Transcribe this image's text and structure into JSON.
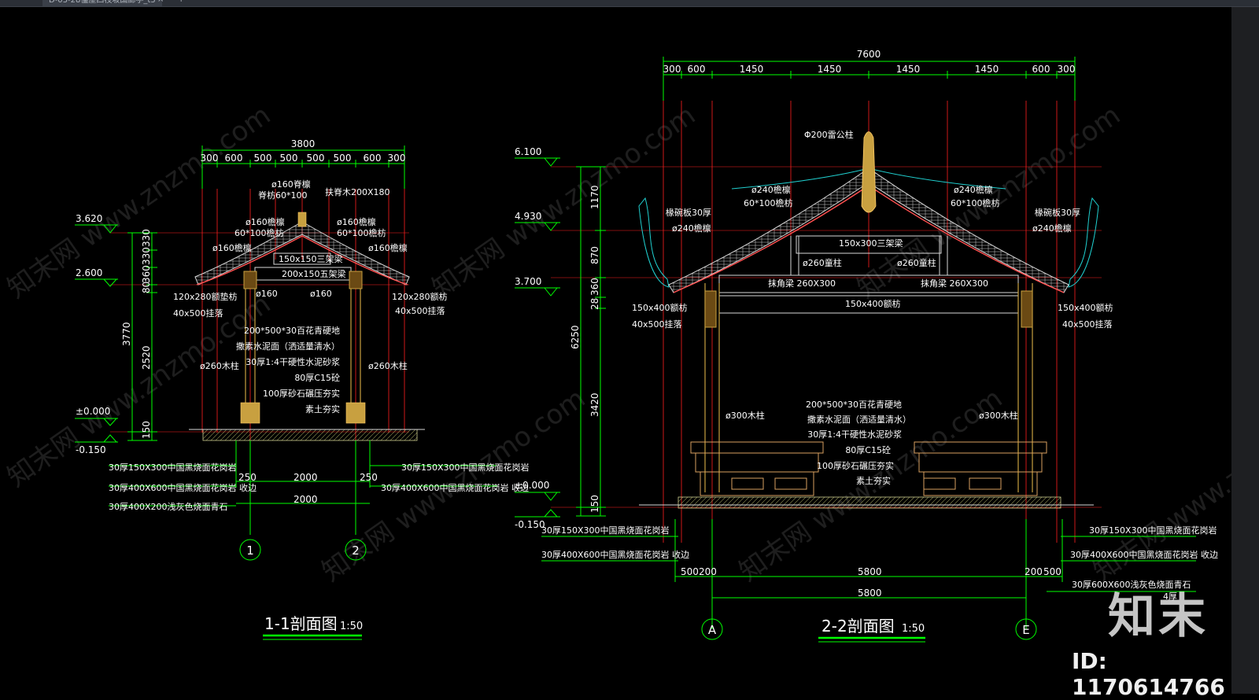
{
  "tab": {
    "title": "D-03-28僵屋四枝坡国廊亭_t3",
    "close": "×",
    "add": "+"
  },
  "watermark": {
    "text": "知末网 www.znzmo.com",
    "brand": "知末",
    "id": "ID: 1170614766"
  },
  "colors": {
    "frame": "#ffffff",
    "dim": "#00ff00",
    "axis": "#ff2020",
    "roof": "#d9d9d9",
    "timber": "#c8a040",
    "cyan": "#20d0d0",
    "text": "#ffffff"
  },
  "section1": {
    "title": "1-1剖面图",
    "scale": "1:50",
    "overall_dim": "3800",
    "top_dims": [
      "300",
      "600",
      "500",
      "500",
      "500",
      "500",
      "600",
      "300"
    ],
    "levels": [
      "3.620",
      "2.600",
      "±0.000",
      "-0.150"
    ],
    "vert_dims": [
      "330",
      "330",
      "360",
      "80",
      "2520",
      "3770",
      "150"
    ],
    "bottom_dims": [
      "250",
      "2000",
      "250",
      "2000"
    ],
    "axes": [
      "1",
      "2"
    ],
    "labels": {
      "ridge": "ø160脊檩",
      "ridge_tie": "脊枋60*100",
      "fuxi": "扶脊木200X180",
      "purlin_l": "ø160檐檩",
      "purlin_r": "ø160檐檩",
      "fang_l": "60*100檐枋",
      "fang_r": "60*100檐枋",
      "eave_l": "ø160檐檩",
      "eave_r": "ø160檐檩",
      "beam3": "150x150三架梁",
      "beam5": "200x150五架梁",
      "dian_l": "120x280额垫枋",
      "dian_r": "120x280额枋",
      "post_l": "ø160",
      "post_r": "ø160",
      "gua_l": "40x500挂落",
      "gua_r": "40x500挂落",
      "col_l": "ø260木柱",
      "col_r": "ø260木柱"
    },
    "floor_layers": [
      "200*500*30百花青硬地",
      "撒素水泥面（洒适量清水）",
      "30厚1:4干硬性水泥砂浆",
      "80厚C15砼",
      "100厚砂石碾压夯实",
      "素土夯实"
    ],
    "paving": [
      "30厚150X300中国黑烧面花岗岩",
      "30厚400X600中国黑烧面花岗岩 收边",
      "30厚400X200浅灰色烧面青石",
      "30厚150X300中国黑烧面花岗岩",
      "30厚400X600中国黑烧面花岗岩 收边"
    ]
  },
  "section2": {
    "title": "2-2剖面图",
    "scale": "1:50",
    "overall_dim": "7600",
    "top_dims": [
      "300",
      "600",
      "1450",
      "1450",
      "1450",
      "1450",
      "600",
      "300"
    ],
    "levels": [
      "6.100",
      "4.930",
      "3.700",
      "±0.000",
      "-0.150"
    ],
    "vert_dims": [
      "1170",
      "870",
      "360",
      "28",
      "6250",
      "3420",
      "150"
    ],
    "bottom_dims": [
      "500",
      "200",
      "5800",
      "200",
      "500",
      "5800"
    ],
    "axes": [
      "A",
      "E"
    ],
    "labels": {
      "ridge_post": "Φ200雷公柱",
      "purlin_l": "ø240檐檩",
      "purlin_r": "ø240檐檩",
      "fang_l": "60*100檐枋",
      "fang_r": "60*100檐枋",
      "board_l": "椽碗板30厚",
      "board_r": "椽碗板30厚",
      "eave_l": "ø240檐檩",
      "eave_r": "ø240檐檩",
      "beam3": "150x300三架梁",
      "tong_l": "ø260童柱",
      "tong_r": "ø260童柱",
      "beam_l": "抹角梁 260X300",
      "beam_r": "抹角梁 260X300",
      "e_fang": "150x400额枋",
      "fang_side_l": "150x400额枋",
      "fang_side_r": "150x400额枋",
      "gua_l": "40x500挂落",
      "gua_r": "40x500挂落",
      "col_l": "ø300木柱",
      "col_r": "ø300木柱"
    },
    "floor_layers": [
      "200*500*30百花青硬地",
      "撒素水泥面（洒适量清水）",
      "30厚1:4干硬性水泥砂浆",
      "80厚C15砼",
      "100厚砂石碾压夯实",
      "素土夯实"
    ],
    "paving": [
      "30厚150X300中国黑烧面花岗岩",
      "30厚400X600中国黑烧面花岗岩 收边",
      "30厚150X300中国黑烧面花岗岩",
      "30厚400X600中国黑烧面花岗岩 收边",
      "30厚600X600浅灰色烧面青石",
      "4厚"
    ]
  }
}
